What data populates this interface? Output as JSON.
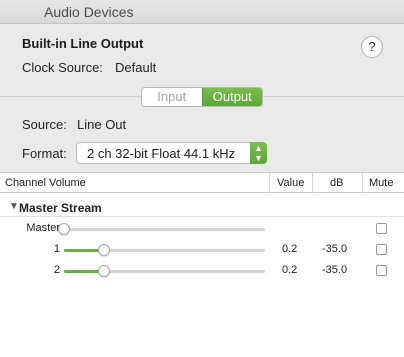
{
  "window": {
    "title": "Audio Devices"
  },
  "device": {
    "name": "Built-in Line Output",
    "clock_label": "Clock Source:",
    "clock_value": "Default",
    "help_label": "?"
  },
  "segment": {
    "input": "Input",
    "output": "Output",
    "selected": "Output"
  },
  "source": {
    "label": "Source:",
    "value": "Line Out"
  },
  "format": {
    "label": "Format:",
    "value": "2 ch 32-bit Float 44.1 kHz",
    "stepper": "⌃⌄"
  },
  "table": {
    "headers": {
      "channel": "Channel Volume",
      "value": "Value",
      "db": "dB",
      "mute": "Mute"
    },
    "group": {
      "triangle": "▼",
      "name": "Master Stream"
    },
    "rows": [
      {
        "label": "Master",
        "value": "",
        "db": "",
        "level": 0.0,
        "muted": false
      },
      {
        "label": "1",
        "value": "0.2",
        "db": "-35.0",
        "level": 0.2,
        "muted": false
      },
      {
        "label": "2",
        "value": "0.2",
        "db": "-35.0",
        "level": 0.2,
        "muted": false
      }
    ]
  },
  "colors": {
    "accent": "#6aad45"
  }
}
